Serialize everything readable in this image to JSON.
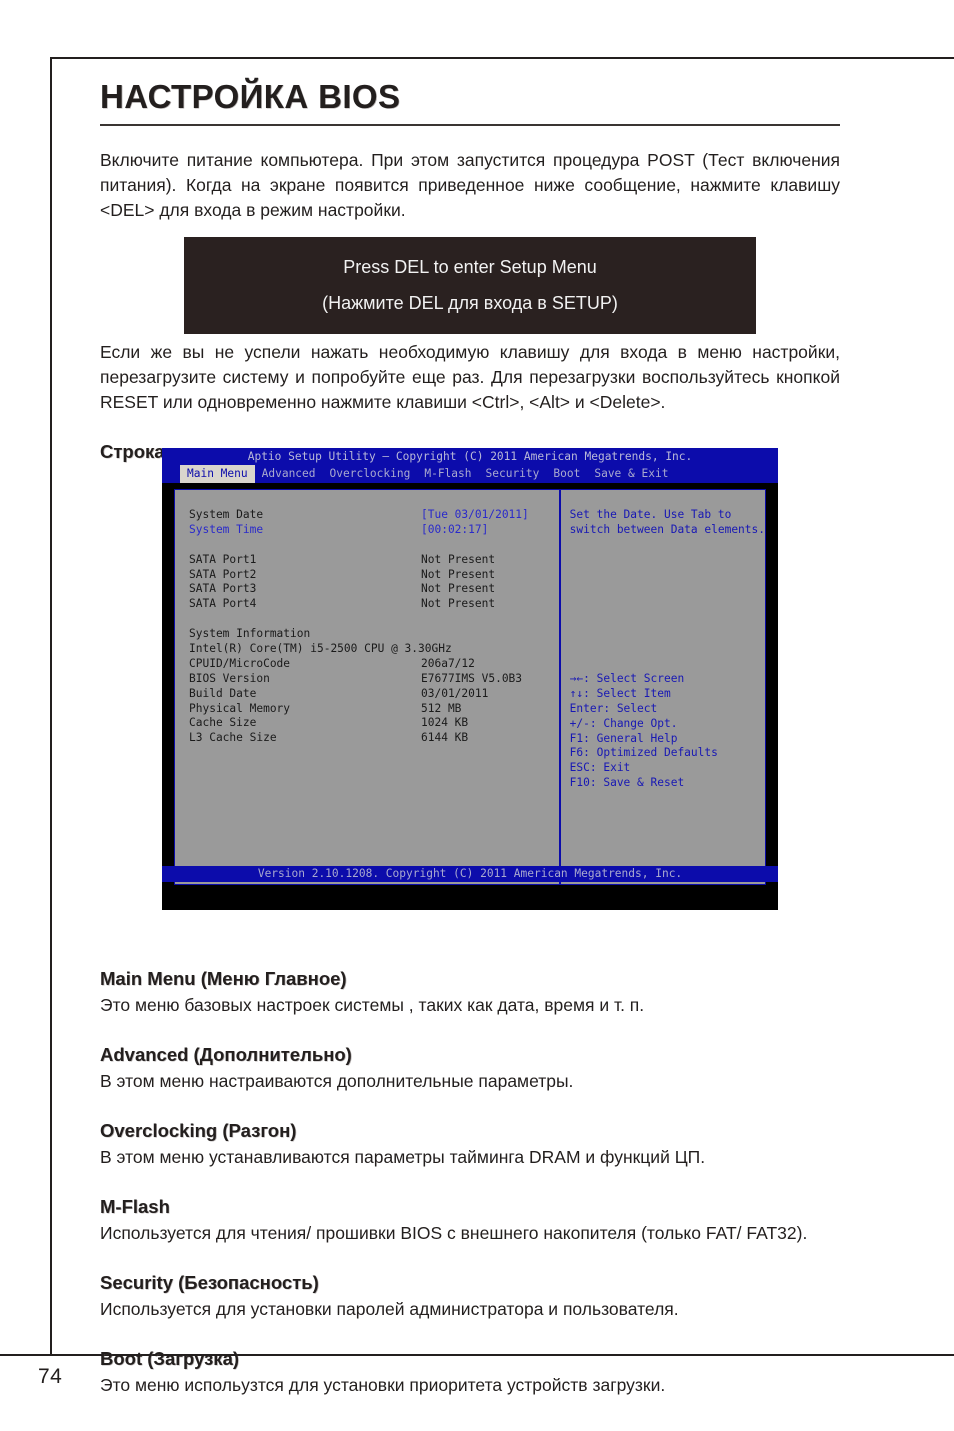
{
  "page": {
    "number": "74",
    "title": "НАСТРОЙКА BIOS"
  },
  "intro": {
    "paragraph": "Включите питание компьютера. При этом запустится процедура POST (Тест включения питания). Когда на экране появится приведенное ниже сообщение, нажмите клавишу <DEL> для входа в режим настройки."
  },
  "post_message": {
    "line_en": "Press DEL to enter Setup Menu",
    "line_ru": "(Нажмите DEL для входа в SETUP)"
  },
  "retry": {
    "paragraph": "Если же вы не успели нажать необходимую клавишу для входа в меню настройки, перезагрузите систему и попробуйте еще раз. Для перезагрузки воспользуйтесь кнопкой RESET или одновременно нажмите клавиши <Ctrl>, <Alt> и <Delete>."
  },
  "menu_bar_heading": "Строка меню",
  "bios": {
    "titlebar": "Aptio Setup Utility – Copyright (C) 2011 American Megatrends, Inc.",
    "tabs": [
      {
        "label": "Main Menu",
        "active": true
      },
      {
        "label": "Advanced",
        "active": false
      },
      {
        "label": "Overclocking",
        "active": false
      },
      {
        "label": "M-Flash",
        "active": false
      },
      {
        "label": "Security",
        "active": false
      },
      {
        "label": "Boot",
        "active": false
      },
      {
        "label": "Save & Exit",
        "active": false
      }
    ],
    "rows": [
      {
        "label": "System Date",
        "value": "[Tue 03/01/2011]",
        "selected": false,
        "value_blue": true
      },
      {
        "label": "System Time",
        "value": "[00:02:17]",
        "selected": true,
        "value_blue": true
      },
      {
        "spacer": true
      },
      {
        "label": "SATA Port1",
        "value": "Not Present"
      },
      {
        "label": "SATA Port2",
        "value": "Not Present"
      },
      {
        "label": "SATA Port3",
        "value": "Not Present"
      },
      {
        "label": "SATA Port4",
        "value": "Not Present"
      },
      {
        "spacer": true
      },
      {
        "label": "System Information",
        "value": ""
      },
      {
        "label": "Intel(R) Core(TM) i5-2500 CPU @ 3.30GHz",
        "value": ""
      },
      {
        "label": "CPUID/MicroCode",
        "value": "206a7/12"
      },
      {
        "label": "BIOS Version",
        "value": "E7677IMS V5.0B3"
      },
      {
        "label": "Build Date",
        "value": "03/01/2011"
      },
      {
        "label": "Physical Memory",
        "value": " 512 MB"
      },
      {
        "label": "Cache Size",
        "value": "1024 KB"
      },
      {
        "label": "L3 Cache Size",
        "value": "6144 KB"
      }
    ],
    "help": [
      "Set the Date. Use Tab to",
      "switch between Data elements."
    ],
    "keys": [
      "→←: Select Screen",
      "↑↓: Select Item",
      "Enter: Select",
      "+/-: Change Opt.",
      "F1: General Help",
      "F6: Optimized Defaults",
      "ESC: Exit",
      "F10: Save & Reset"
    ],
    "footer": "Version 2.10.1208. Copyright (C) 2011 American Megatrends, Inc."
  },
  "sections": [
    {
      "heading": "Main Menu (Меню Главное)",
      "text": "Это меню базовых настроек системы , таких как дата, время и т. п."
    },
    {
      "heading": "Advanced (Дополнительно)",
      "text": "В этом меню настраиваются дополнительные параметры."
    },
    {
      "heading": "Overclocking (Разгон)",
      "text": "В этом меню устанавливаются параметры тайминга DRAM и функций ЦП."
    },
    {
      "heading": "M-Flash",
      "text": "Используется для чтения/ прошивки BIOS с внешнего накопителя (только FAT/ FAT32)."
    },
    {
      "heading": "Security (Безопасность)",
      "text": "Используется для установки паролей администратора и пользователя."
    },
    {
      "heading": "Boot (Загрузка)",
      "text": "Это меню испольузтся для установки приоритета устройств загрузки."
    }
  ],
  "colors": {
    "bios_blue": "#0c0cab",
    "bios_gray_panel": "#9a9a9a",
    "bios_text_blue": "#1818b4",
    "post_box_bg": "#2a2120",
    "ink": "#231f1e"
  }
}
